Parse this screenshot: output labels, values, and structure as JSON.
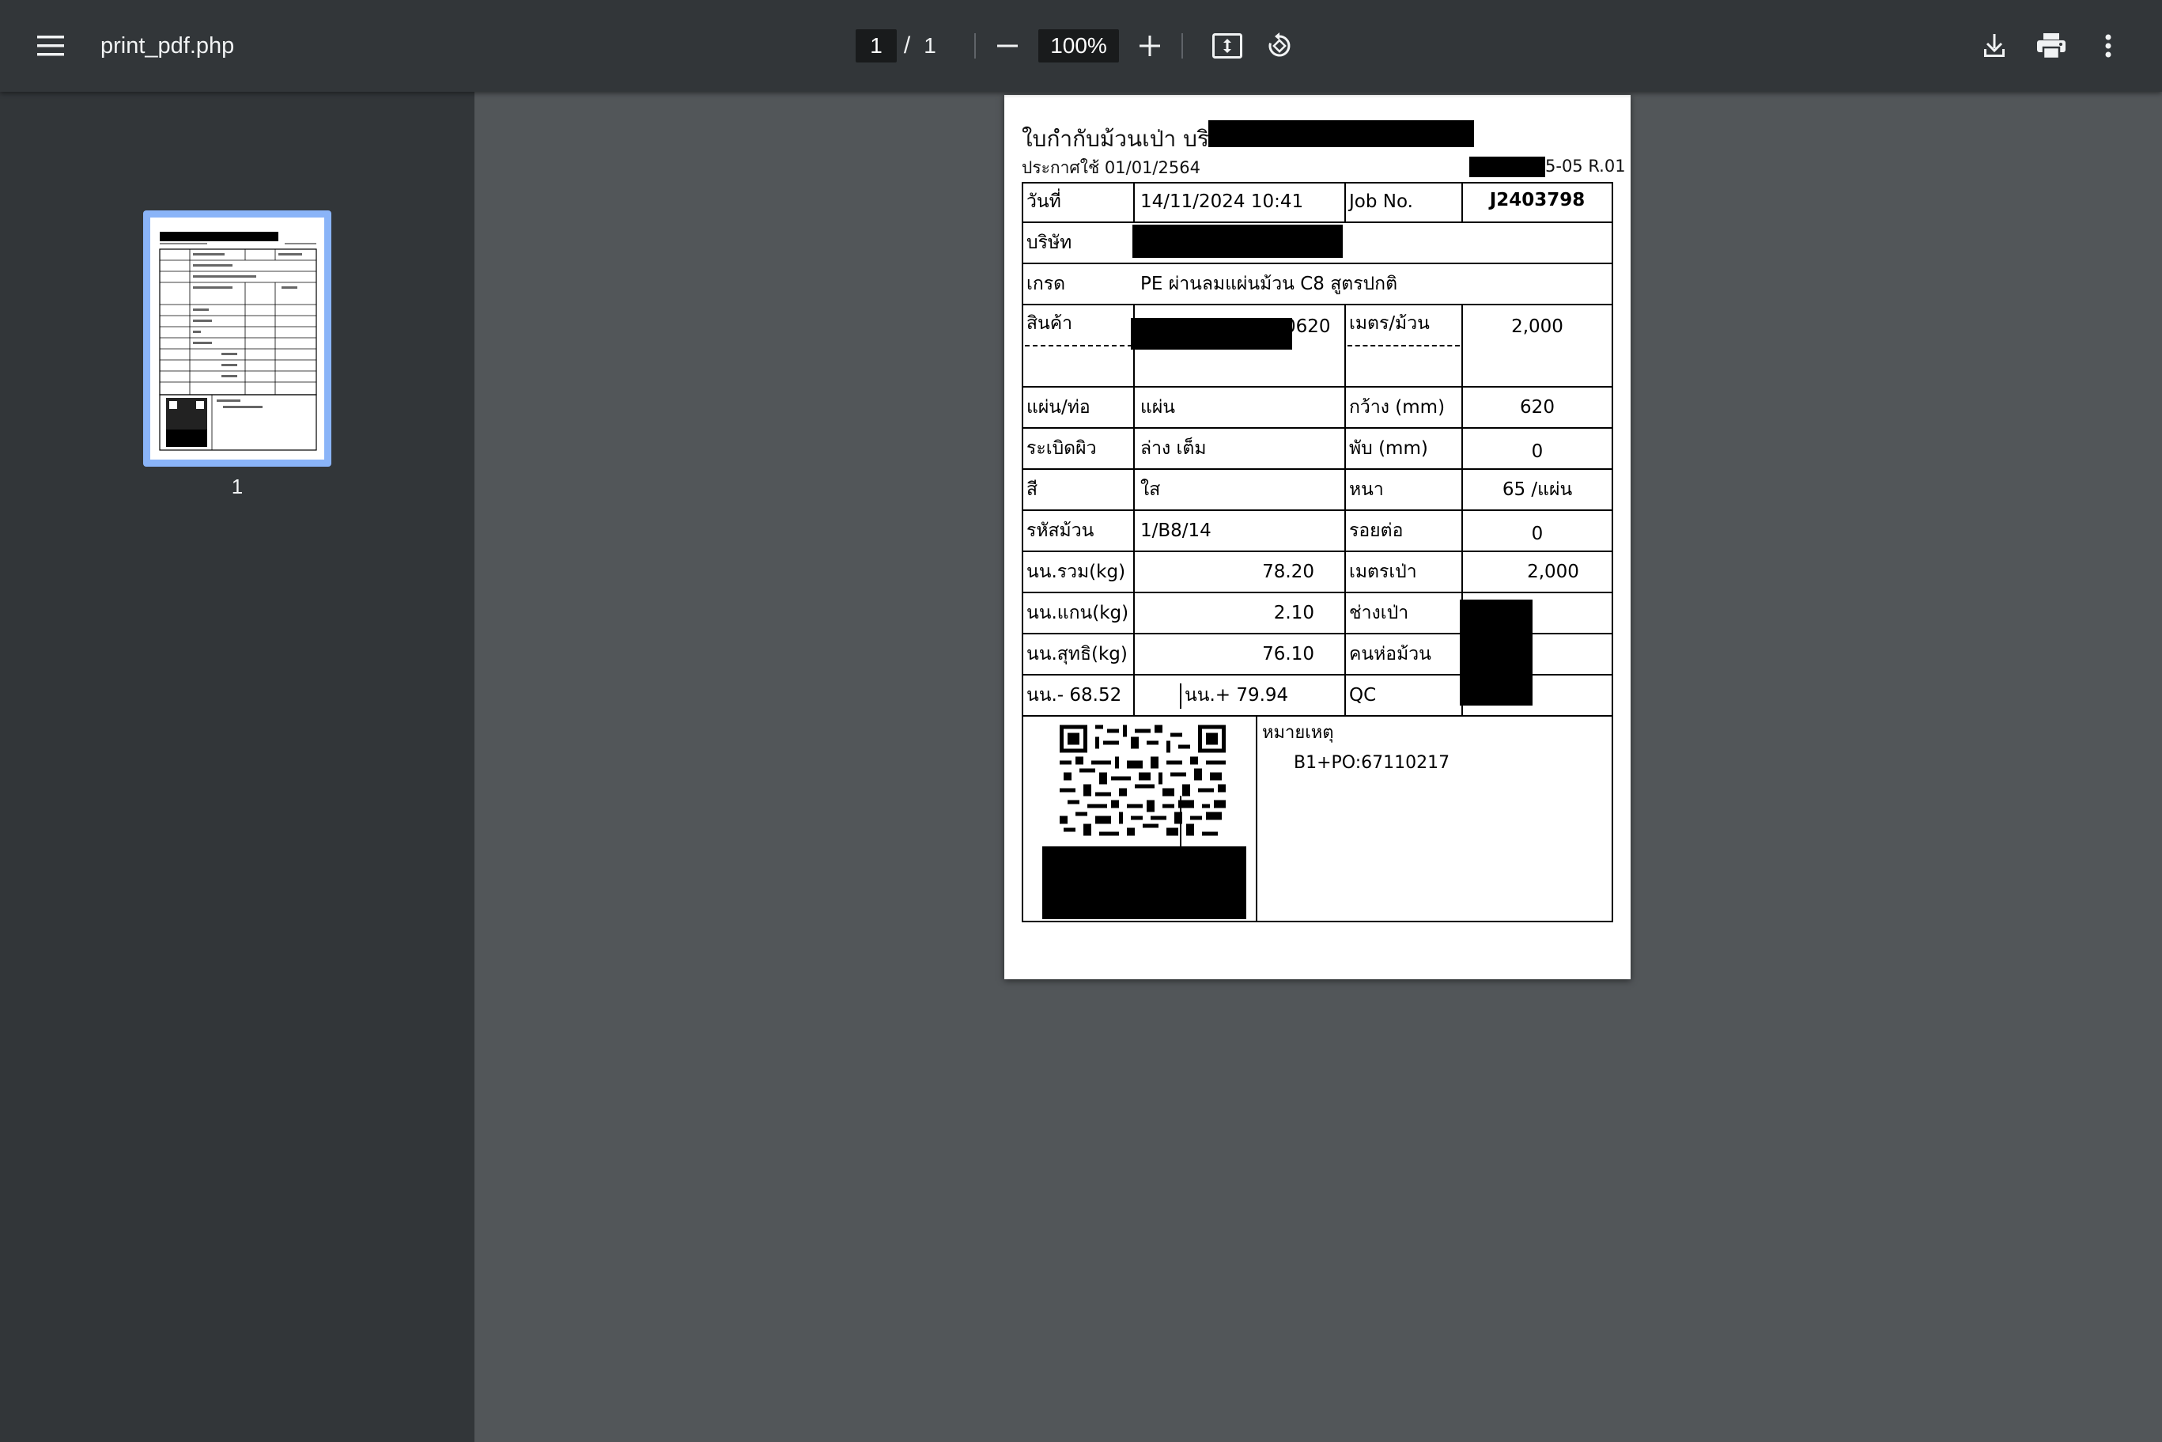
{
  "toolbar": {
    "title": "print_pdf.php",
    "page_current": "1",
    "page_separator": "/",
    "page_total": "1",
    "zoom": "100%"
  },
  "sidebar": {
    "thumbnail_label": "1"
  },
  "document": {
    "heading": "ใบกำกับม้วนเป่า บริ",
    "announce": "ประกาศใช้ 01/01/2564",
    "doc_code": "5-05 R.01",
    "date_label": "วันที่",
    "date_value": "14/11/2024 10:41",
    "job_label": "Job No.",
    "job_value": "J2403798",
    "company_label": "บริษัท",
    "grade_label": "เกรด",
    "grade_value": "PE ผ่านลมแผ่นม้วน C8 สูตรปกติ",
    "product_label": "สินค้า",
    "product_value_suffix": "0620",
    "meter_per_roll_label": "เมตร/ม้วน",
    "meter_per_roll_value": "2,000",
    "sheet_label": "แผ่น/ท่อ",
    "sheet_value": "แผ่น",
    "width_label": "กว้าง (mm)",
    "width_value": "620",
    "corona_label": "ระเบิดผิว",
    "corona_value": "ล่าง เต็ม",
    "fold_label": "พับ (mm)",
    "fold_value": "0",
    "color_label": "สี",
    "color_value": "ใส",
    "thick_label": "หนา",
    "thick_value": "65 /แผ่น",
    "roll_code_label": "รหัสม้วน",
    "roll_code_value": "1/B8/14",
    "joint_label": "รอยต่อ",
    "joint_value": "0",
    "gross_label": "นน.รวม(kg)",
    "gross_value": "78.20",
    "blown_meter_label": "เมตรเป่า",
    "blown_meter_value": "2,000",
    "core_label": "นน.แกน(kg)",
    "core_value": "2.10",
    "blower_label": "ช่างเป่า",
    "net_label": "นน.สุทธิ(kg)",
    "net_value": "76.10",
    "packer_label": "คนห่อม้วน",
    "min_label": "นน.- 68.52",
    "max_label": "นน.+ 79.94",
    "qc_label": "QC",
    "remark_label": "หมายเหตุ",
    "remark_value": "B1+PO:67110217"
  },
  "icons": {
    "menu": "menu-icon",
    "zoom_out": "minus-icon",
    "zoom_in": "plus-icon",
    "fit": "fit-page-icon",
    "rotate": "rotate-icon",
    "download": "download-icon",
    "print": "print-icon",
    "more": "more-vert-icon"
  },
  "colors": {
    "toolbar_bg": "#323639",
    "viewer_bg": "#525659",
    "thumb_highlight": "#8ab4f8"
  }
}
